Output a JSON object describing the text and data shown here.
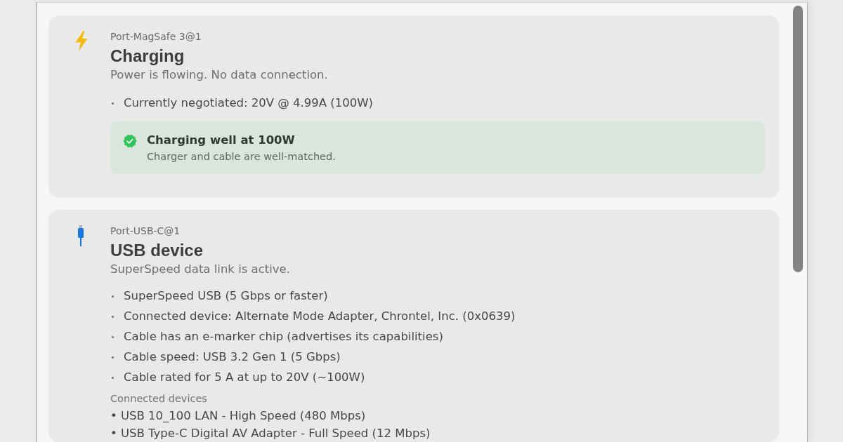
{
  "ports": [
    {
      "kind": "magsafe",
      "port": "Port-MagSafe 3@1",
      "title": "Charging",
      "summary": "Power is flowing. No data connection.",
      "details": [
        "Currently negotiated: 20V @ 4.99A (100W)"
      ],
      "notice": {
        "kind": "success",
        "title": "Charging well at 100W",
        "text": "Charger and cable are well-matched."
      }
    },
    {
      "kind": "usb",
      "port": "Port-USB-C@1",
      "title": "USB device",
      "summary": "SuperSpeed data link is active.",
      "details": [
        "SuperSpeed USB (5 Gbps or faster)",
        "Connected device: Alternate Mode Adapter, Chrontel, Inc. (0x0639)",
        "Cable has an e-marker chip (advertises its capabilities)",
        "Cable speed: USB 3.2 Gen 1 (5 Gbps)",
        "Cable rated for 5 A at up to 20V (~100W)"
      ],
      "devices_heading": "Connected devices",
      "devices": [
        "• USB 10_100 LAN - High Speed (480 Mbps)",
        "• USB Type-C Digital AV Adapter - Full Speed (12 Mbps)"
      ]
    }
  ]
}
